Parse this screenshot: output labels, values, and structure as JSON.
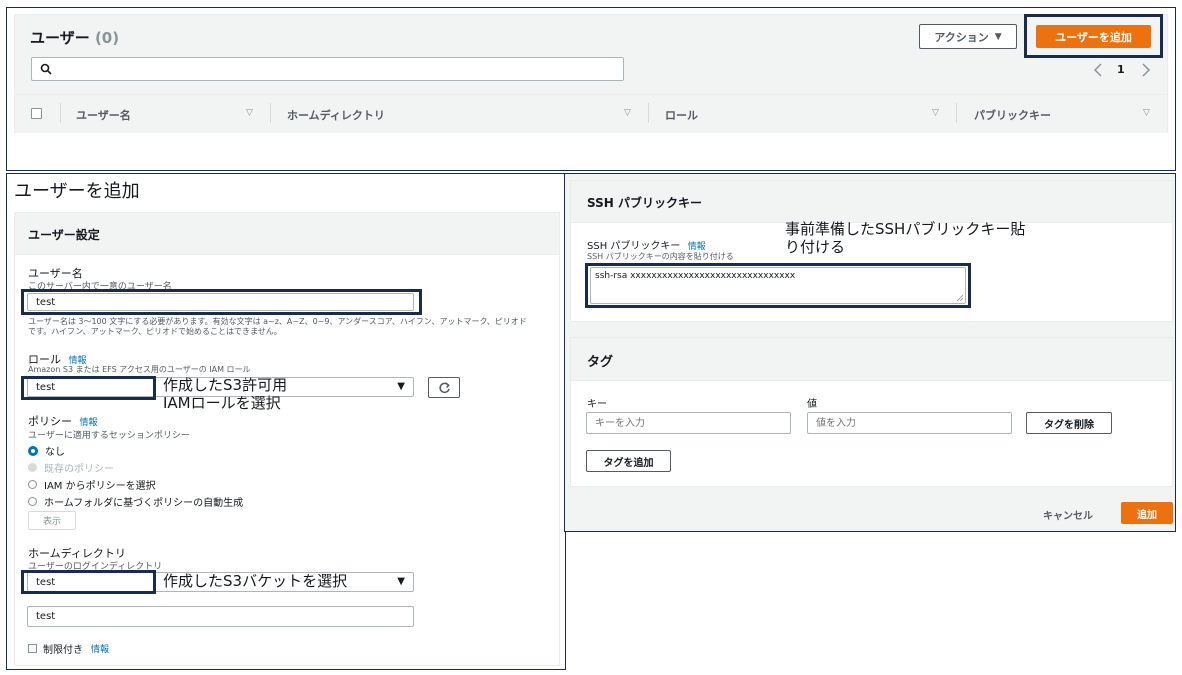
{
  "users_panel": {
    "title": "ユーザー",
    "count": "(0)",
    "actions_label": "アクション",
    "actions_caret": "▼",
    "add_user_label": "ユーザーを追加",
    "page_number": "1",
    "columns": [
      "ユーザー名",
      "ホームディレクトリ",
      "ロール",
      "パブリックキー"
    ]
  },
  "add_user_page": {
    "title": "ユーザーを追加",
    "settings_title": "ユーザー設定",
    "username_label": "ユーザー名",
    "username_desc": "このサーバー内で一意のユーザー名",
    "username_value": "test",
    "username_hint_1": "ユーザー名は 3～100 文字にする必要があります。有効な文字は a~z、A~Z、0~9、アンダースコア、ハイフン、アットマーク、ピリオド",
    "username_hint_2": "です。ハイフン、アットマーク、ピリオドで始めることはできません。",
    "role_label": "ロール",
    "role_info": "情報",
    "role_desc": "Amazon S3 または EFS アクセス用のユーザーの IAM ロール",
    "role_value": "test",
    "policy_label": "ポリシー",
    "policy_info": "情報",
    "policy_desc": "ユーザーに適用するセッションポリシー",
    "policy_options": [
      "なし",
      "既存のポリシー",
      "IAM からポリシーを選択",
      "ホームフォルダに基づくポリシーの自動生成"
    ],
    "show_label": "表示",
    "home_label": "ホームディレクトリ",
    "home_desc": "ユーザーのログインディレクトリ",
    "home_bucket_value": "test",
    "home_path_value": "test",
    "restricted_label": "制限付き",
    "restricted_info": "情報"
  },
  "ssh_panel": {
    "title": "SSH パブリックキー",
    "field_label": "SSH パブリックキー",
    "field_info": "情報",
    "field_desc": "SSH パブリックキーの内容を貼り付ける",
    "key_value": "ssh-rsa xxxxxxxxxxxxxxxxxxxxxxxxxxxxxxx"
  },
  "tags_panel": {
    "title": "タグ",
    "key_label": "キー",
    "value_label": "値",
    "key_placeholder": "キーを入力",
    "value_placeholder": "値を入力",
    "remove_tag_label": "タグを削除",
    "add_tag_label": "タグを追加"
  },
  "footer": {
    "cancel_label": "キャンセル",
    "submit_label": "追加"
  },
  "annotations": {
    "ssh_note_line1": "事前準備したSSHパブリックキー貼",
    "ssh_note_line2": "り付ける",
    "role_note_line1": "作成したS3許可用",
    "role_note_line2": "IAMロールを選択",
    "bucket_note": "作成したS3バケットを選択"
  },
  "colors": {
    "primary": "#ec7211",
    "highlight_border": "#1b2b4b",
    "link": "#0073bb"
  },
  "icons": [
    "search-icon",
    "chevron-left-icon",
    "chevron-right-icon",
    "sort-icon",
    "caret-down-icon",
    "refresh-icon",
    "resize-handle-icon"
  ]
}
